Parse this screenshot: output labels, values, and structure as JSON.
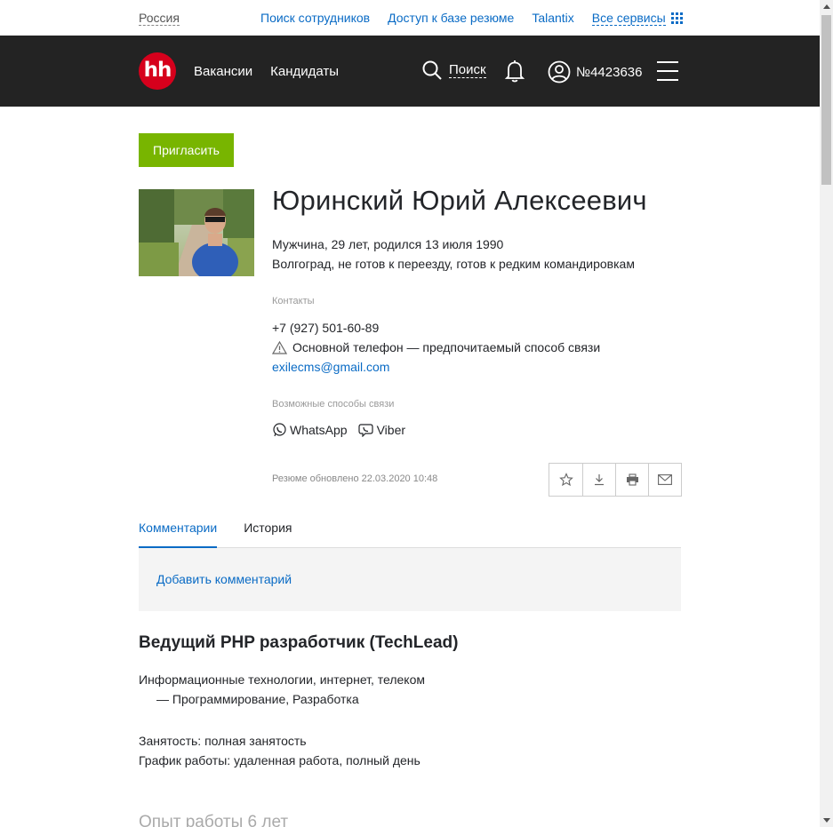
{
  "topbar": {
    "region": "Россия",
    "links": {
      "employee_search": "Поиск сотрудников",
      "resume_db": "Доступ к базе резюме",
      "talantix": "Talantix",
      "all_services": "Все сервисы"
    }
  },
  "header": {
    "logo": "hh",
    "nav": {
      "vacancies": "Вакансии",
      "candidates": "Кандидаты"
    },
    "search_label": "Поиск",
    "account_number": "№4423636"
  },
  "actions": {
    "invite_label": "Пригласить"
  },
  "resume": {
    "name": "Юринский Юрий Алексеевич",
    "summary": "Мужчина, 29 лет, родился 13 июля 1990",
    "location": "Волгоград, не готов к переезду, готов к редким командировкам",
    "contacts_label": "Контакты",
    "phone": "+7 (927) 501-60-89",
    "phone_note": "Основной телефон — предпочитаемый способ связи",
    "email": "exilecms@gmail.com",
    "ways_label": "Возможные способы связи",
    "messengers": {
      "whatsapp": "WhatsApp",
      "viber": "Viber"
    },
    "updated": "Резюме обновлено 22.03.2020 10:48"
  },
  "tabs": {
    "comments": "Комментарии",
    "history": "История"
  },
  "comments": {
    "add_label": "Добавить комментарий"
  },
  "position": {
    "title": "Ведущий PHP разработчик (TechLead)",
    "industry": "Информационные технологии, интернет, телеком",
    "specialization": "— Программирование, Разработка",
    "employment": "Занятость: полная занятость",
    "schedule": "График работы: удаленная работа, полный день"
  },
  "experience_heading": "Опыт работы 6 лет",
  "colors": {
    "accent": "#0a6bc5",
    "invite": "#78b500",
    "logo": "#d6001c",
    "header_bg": "#232323"
  }
}
